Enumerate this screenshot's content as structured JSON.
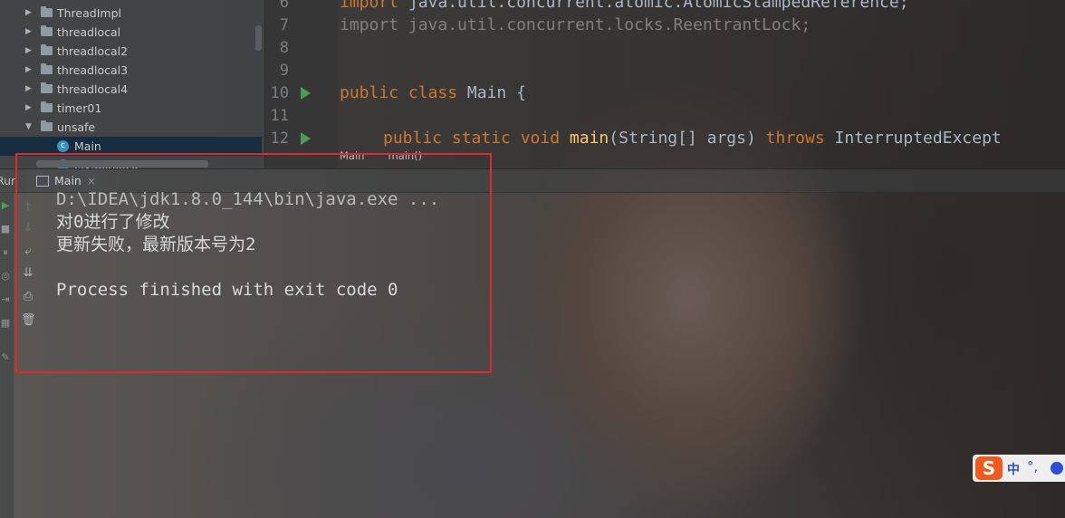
{
  "project_tree": {
    "items": [
      {
        "label": "ThreadImpl",
        "expanded": false
      },
      {
        "label": "threadlocal",
        "expanded": false
      },
      {
        "label": "threadlocal2",
        "expanded": false
      },
      {
        "label": "threadlocal3",
        "expanded": false
      },
      {
        "label": "threadlocal4",
        "expanded": false
      },
      {
        "label": "timer01",
        "expanded": false
      },
      {
        "label": "unsafe",
        "expanded": true
      },
      {
        "label": "Main",
        "type": "class",
        "selected": true
      },
      {
        "label": "MySpinlock",
        "type": "class"
      }
    ]
  },
  "editor": {
    "lines": [
      {
        "no": "6",
        "text": "import java.util.concurrent.atomic.AtomicStampedReference;"
      },
      {
        "no": "7",
        "text": "import java.util.concurrent.locks.ReentrantLock;"
      },
      {
        "no": "8",
        "text": ""
      },
      {
        "no": "9",
        "text": ""
      },
      {
        "no": "10",
        "kw": "public class ",
        "name": "Main",
        "rest": " {"
      },
      {
        "no": "11",
        "text": ""
      },
      {
        "no": "12",
        "kw": "public static void ",
        "name": "main",
        "rest": "(String[] args) ",
        "kw2": "throws",
        "rest2": " InterruptedExcept"
      }
    ],
    "breadcrumb": [
      "Main",
      "main()"
    ]
  },
  "run_panel": {
    "label": "Run",
    "tab_label": "Main",
    "tab_close": "×",
    "console": [
      "D:\\IDEA\\jdk1.8.0_144\\bin\\java.exe ...",
      "对0进行了修改",
      "更新失败，最新版本号为2",
      "",
      "Process finished with exit code 0"
    ]
  },
  "ime": {
    "logo": "S",
    "mode": "中",
    "punct": "°,"
  },
  "colors": {
    "keyword": "#cc7832",
    "annotation_box": "#e02a2a",
    "run_arrow": "#499c54"
  }
}
